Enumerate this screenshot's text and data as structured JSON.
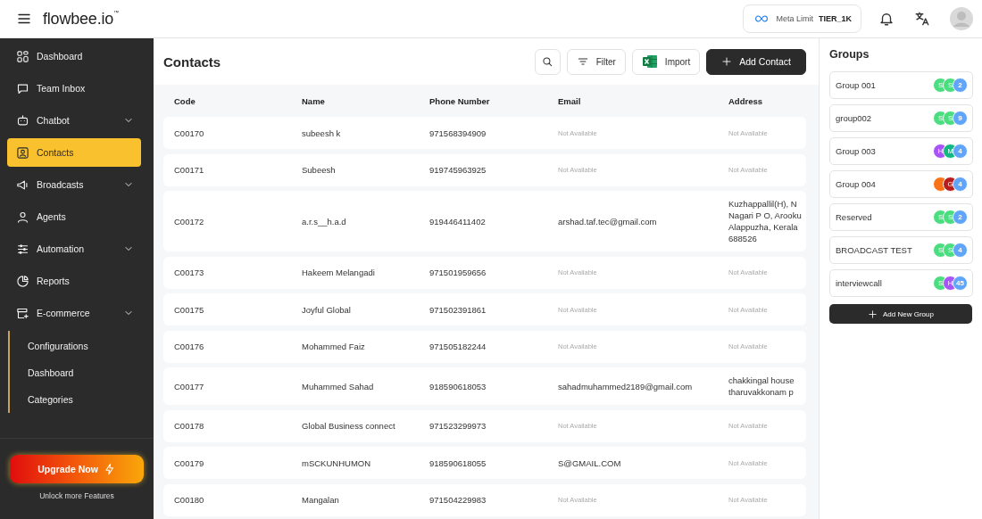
{
  "header": {
    "logo": "flowbee.io",
    "logo_mark": "™",
    "meta_limit": {
      "label": "Meta Limit",
      "tier": "TIER_1K"
    }
  },
  "sidebar": {
    "items": [
      {
        "label": "Dashboard",
        "kind": "link",
        "selected": false
      },
      {
        "label": "Team Inbox",
        "kind": "link",
        "selected": false
      },
      {
        "label": "Chatbot",
        "kind": "menu",
        "selected": false
      },
      {
        "label": "Contacts",
        "kind": "link",
        "selected": true
      },
      {
        "label": "Broadcasts",
        "kind": "menu",
        "selected": false
      },
      {
        "label": "Agents",
        "kind": "link",
        "selected": false
      },
      {
        "label": "Automation",
        "kind": "menu",
        "selected": false
      },
      {
        "label": "Reports",
        "kind": "link",
        "selected": false
      },
      {
        "label": "E-commerce",
        "kind": "menu",
        "selected": false,
        "children": [
          {
            "label": "Configurations",
            "selected": false
          },
          {
            "label": "Dashboard",
            "selected": false
          },
          {
            "label": "Categories",
            "selected": false
          }
        ]
      }
    ],
    "upgrade": {
      "label": "Upgrade Now",
      "caption": "Unlock more Features"
    }
  },
  "contacts": {
    "title": "Contacts",
    "buttons": [
      {
        "kind": "search"
      },
      {
        "kind": "filter",
        "label": "Filter"
      },
      {
        "kind": "import",
        "label": "Import"
      },
      {
        "kind": "add",
        "label": "Add Contact"
      }
    ],
    "table": {
      "columns": [
        "Code",
        "Name",
        "Phone Number",
        "Email",
        "Address"
      ],
      "rows": [
        {
          "code": "C00170",
          "name": "subeesh k",
          "phone": "971568394909",
          "email": {
            "text": "Not Available",
            "available": false
          },
          "address": {
            "lines": [
              "Not Available"
            ],
            "available": false
          }
        },
        {
          "code": "C00171",
          "name": "Subeesh",
          "phone": "919745963925",
          "email": {
            "text": "Not Available",
            "available": false
          },
          "address": {
            "lines": [
              "Not Available"
            ],
            "available": false
          }
        },
        {
          "code": "C00172",
          "name": "a.r.s__h.a.d",
          "phone": "919446411402",
          "email": {
            "text": "arshad.taf.tec@gmail.com",
            "available": true
          },
          "address": {
            "lines": [
              "Kuzhappallil(H), N",
              "Nagari P O, Arooku",
              "Alappuzha, Kerala",
              "688526"
            ],
            "available": true
          }
        },
        {
          "code": "C00173",
          "name": "Hakeem Melangadi",
          "phone": "971501959656",
          "email": {
            "text": "Not Available",
            "available": false
          },
          "address": {
            "lines": [
              "Not Available"
            ],
            "available": false
          }
        },
        {
          "code": "C00175",
          "name": "Joyful Global",
          "phone": "971502391861",
          "email": {
            "text": "Not Available",
            "available": false
          },
          "address": {
            "lines": [
              "Not Available"
            ],
            "available": false
          }
        },
        {
          "code": "C00176",
          "name": "Mohammed Faiz",
          "phone": "971505182244",
          "email": {
            "text": "Not Available",
            "available": false
          },
          "address": {
            "lines": [
              "Not Available"
            ],
            "available": false
          }
        },
        {
          "code": "C00177",
          "name": "Muhammed Sahad",
          "phone": "918590618053",
          "email": {
            "text": "sahadmuhammed2189@gmail.com",
            "available": true
          },
          "address": {
            "lines": [
              "chakkingal house",
              "tharuvakkonam p"
            ],
            "available": true
          }
        },
        {
          "code": "C00178",
          "name": "Global Business connect",
          "phone": "971523299973",
          "email": {
            "text": "Not Available",
            "available": false
          },
          "address": {
            "lines": [
              "Not Available"
            ],
            "available": false
          }
        },
        {
          "code": "C00179",
          "name": "mSCKUNHUMON",
          "phone": "918590618055",
          "email": {
            "text": "S@GMAIL.COM",
            "available": true
          },
          "address": {
            "lines": [
              "Not Available"
            ],
            "available": false
          }
        },
        {
          "code": "C00180",
          "name": "Mangalan",
          "phone": "971504229983",
          "email": {
            "text": "Not Available",
            "available": false
          },
          "address": {
            "lines": [
              "Not Available"
            ],
            "available": false
          }
        }
      ]
    }
  },
  "groups": {
    "title": "Groups",
    "items": [
      {
        "name": "Group 001",
        "avatars": [
          {
            "letter": "S",
            "color": "#4ade80"
          },
          {
            "letter": "S",
            "color": "#4ade80"
          }
        ],
        "count": "2"
      },
      {
        "name": "group002",
        "avatars": [
          {
            "letter": "S",
            "color": "#4ade80"
          },
          {
            "letter": "S",
            "color": "#4ade80"
          }
        ],
        "count": "9"
      },
      {
        "name": "Group 003",
        "avatars": [
          {
            "letter": "H",
            "color": "#a855f7"
          },
          {
            "letter": "M",
            "color": "#10b981"
          }
        ],
        "count": "4"
      },
      {
        "name": "Group 004",
        "avatars": [
          {
            "color": "#f97316"
          },
          {
            "letter": "G",
            "color": "#b91c1c"
          }
        ],
        "count": "4"
      },
      {
        "name": "Reserved",
        "avatars": [
          {
            "letter": "S",
            "color": "#4ade80"
          },
          {
            "letter": "S",
            "color": "#4ade80"
          }
        ],
        "count": "2"
      },
      {
        "name": "BROADCAST TEST",
        "avatars": [
          {
            "letter": "S",
            "color": "#4ade80"
          },
          {
            "letter": "S",
            "color": "#4ade80"
          }
        ],
        "count": "4"
      },
      {
        "name": "interviewcall",
        "avatars": [
          {
            "letter": "S",
            "color": "#4ade80"
          },
          {
            "letter": "H",
            "color": "#a855f7"
          }
        ],
        "count": "45"
      }
    ],
    "add_label": "Add New Group"
  }
}
